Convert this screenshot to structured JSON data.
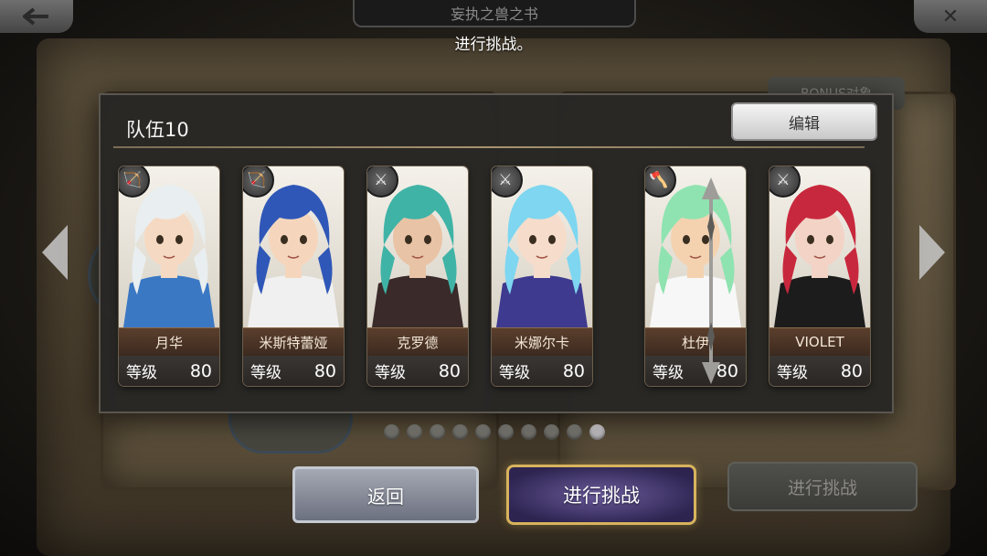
{
  "header": {
    "book_title": "妄执之兽之书",
    "subtitle": "进行挑战。"
  },
  "background": {
    "bonus_label": "BONUS对象",
    "challenge_label": "进行挑战"
  },
  "panel": {
    "team_title": "队伍10",
    "edit_label": "编辑"
  },
  "characters": [
    {
      "name": "月华",
      "level_label": "等级",
      "level": "80",
      "weapon_icon": "bow-icon",
      "hair": "#e9eef0",
      "skin": "#f6d9c2",
      "accent": "#3b78c4"
    },
    {
      "name": "米斯特蕾娅",
      "level_label": "等级",
      "level": "80",
      "weapon_icon": "bow-icon",
      "hair": "#2f57b8",
      "skin": "#f5d6bd",
      "accent": "#f0f0f0"
    },
    {
      "name": "克罗德",
      "level_label": "等级",
      "level": "80",
      "weapon_icon": "sword-icon",
      "hair": "#3fb3a6",
      "skin": "#e9c3a5",
      "accent": "#3a2a2a"
    },
    {
      "name": "米娜尔卡",
      "level_label": "等级",
      "level": "80",
      "weapon_icon": "sword-icon",
      "hair": "#7ed6f0",
      "skin": "#f6dccb",
      "accent": "#3e3a8f"
    },
    {
      "name": "杜伊",
      "level_label": "等级",
      "level": "80",
      "weapon_icon": "axe-icon",
      "hair": "#8fe3b0",
      "skin": "#f4d2b0",
      "accent": "#f7f7f7"
    },
    {
      "name": "VIOLET",
      "level_label": "等级",
      "level": "80",
      "weapon_icon": "sword-icon",
      "hair": "#c8283d",
      "skin": "#f2d3c6",
      "accent": "#1c1c1c"
    }
  ],
  "pagination": {
    "total": 10,
    "current": 10
  },
  "buttons": {
    "back_label": "返回",
    "challenge_label": "进行挑战"
  },
  "colors": {
    "panel_bg": "#28262a",
    "gold_accent": "#d8b35c",
    "name_bar": "#5b3f2d"
  }
}
